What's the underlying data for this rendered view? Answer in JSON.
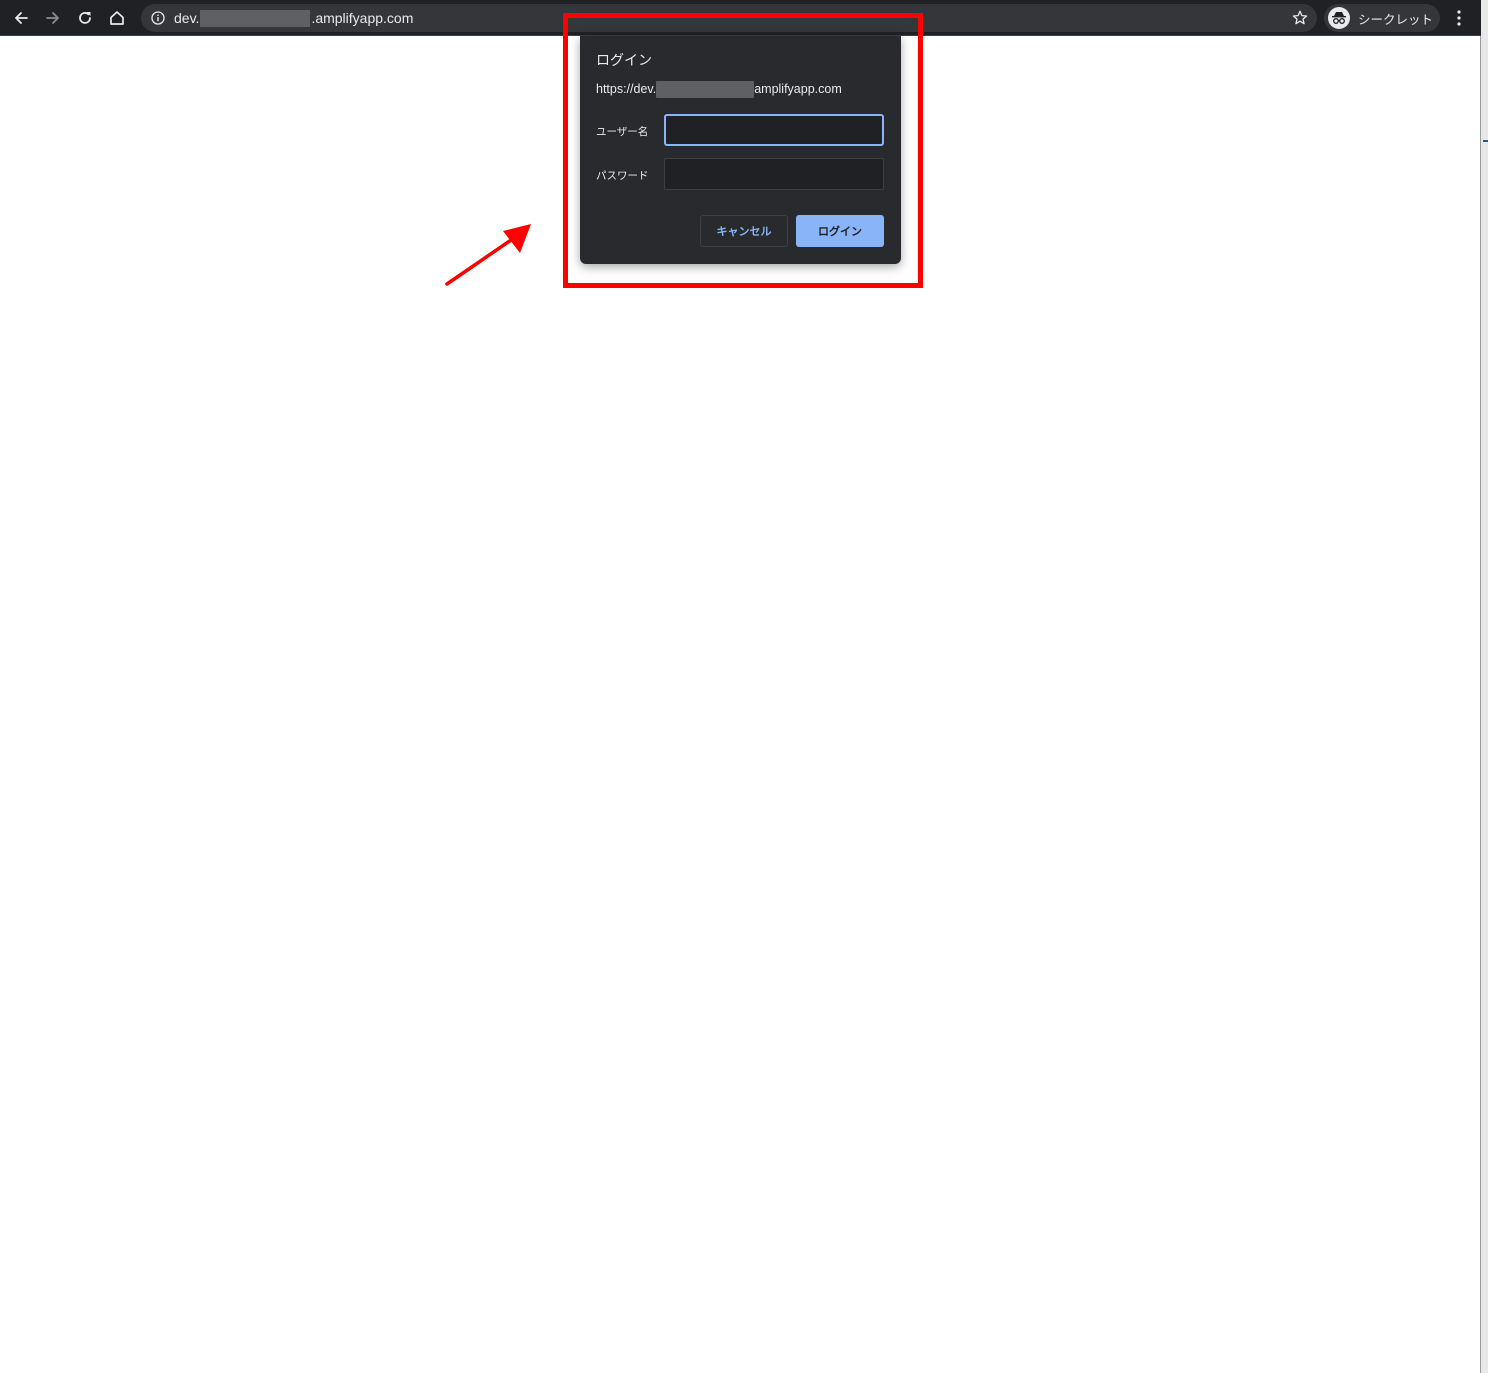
{
  "browser": {
    "toolbar": {
      "back_icon": "arrow-left-icon",
      "forward_icon": "arrow-right-icon",
      "reload_icon": "reload-icon",
      "home_icon": "home-icon"
    },
    "omnibox": {
      "url_prefix": "dev.",
      "url_suffix": ".amplifyapp.com",
      "info_icon": "info-icon",
      "bookmark_icon": "star-icon"
    },
    "profile": {
      "label": "シークレット",
      "icon": "incognito-icon"
    },
    "menu_icon": "kebab-menu-icon"
  },
  "login_dialog": {
    "title": "ログイン",
    "origin_prefix": "https://dev.",
    "origin_suffix": "amplifyapp.com",
    "username_label": "ユーザー名",
    "username_value": "",
    "password_label": "パスワード",
    "password_value": "",
    "cancel_label": "キャンセル",
    "login_label": "ログイン"
  },
  "annotation": {
    "highlight_color": "#ff0000",
    "arrow_color": "#ff0000"
  },
  "colors": {
    "toolbar_bg": "#202124",
    "omnibox_bg": "#35363a",
    "dialog_bg": "#292a2d",
    "accent": "#8ab4f8"
  }
}
